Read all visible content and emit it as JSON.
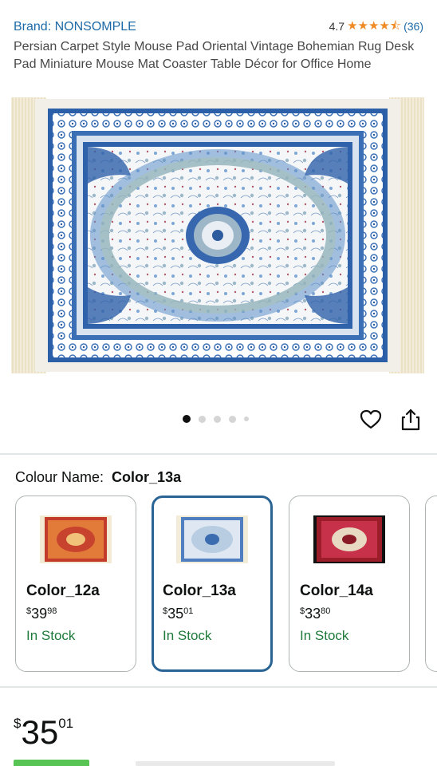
{
  "header": {
    "brand": "Brand: NONSOMPLE",
    "rating_value": "4.7",
    "rating_stars": 4.5,
    "rating_count": "(36)"
  },
  "product": {
    "title": "Persian Carpet Style Mouse Pad Oriental Vintage Bohemian Rug Desk Pad Miniature Mouse Mat Coaster Table Décor for Office Home"
  },
  "gallery": {
    "image_count": 5,
    "active_index": 0
  },
  "actions": {
    "favorite_icon": "heart-icon",
    "share_icon": "share-icon"
  },
  "colour": {
    "label": "Colour Name:",
    "selected": "Color_13a",
    "options": [
      {
        "name": "Color_12a",
        "currency": "$",
        "whole": "39",
        "fraction": "98",
        "stock": "In Stock",
        "tone": "red"
      },
      {
        "name": "Color_13a",
        "currency": "$",
        "whole": "35",
        "fraction": "01",
        "stock": "In Stock",
        "tone": "blue"
      },
      {
        "name": "Color_14a",
        "currency": "$",
        "whole": "33",
        "fraction": "80",
        "stock": "In Stock",
        "tone": "crimson"
      }
    ]
  },
  "price": {
    "currency": "$",
    "whole": "35",
    "fraction": "01"
  },
  "colors": {
    "link": "#1e6aa6",
    "star": "#f08a24",
    "in_stock": "#1d7a3a",
    "selected_border": "#2a6494"
  }
}
